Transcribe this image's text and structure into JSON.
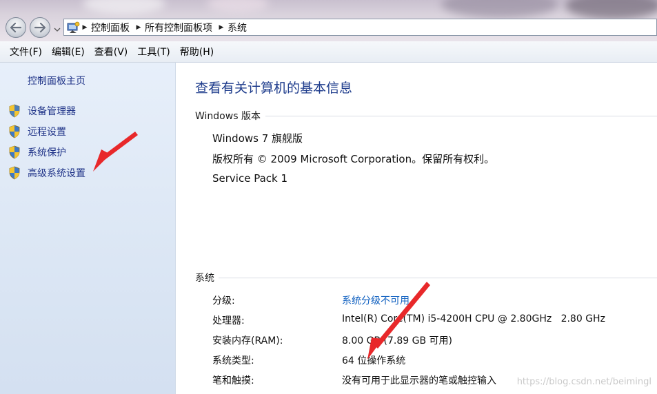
{
  "address": {
    "crumbs": [
      "控制面板",
      "所有控制面板项",
      "系统"
    ]
  },
  "menu": {
    "items": [
      "文件(F)",
      "编辑(E)",
      "查看(V)",
      "工具(T)",
      "帮助(H)"
    ]
  },
  "sidebar": {
    "home_label": "控制面板主页",
    "items": [
      {
        "label": "设备管理器",
        "icon": "shield-icon"
      },
      {
        "label": "远程设置",
        "icon": "shield-icon"
      },
      {
        "label": "系统保护",
        "icon": "shield-icon"
      },
      {
        "label": "高级系统设置",
        "icon": "shield-icon"
      }
    ]
  },
  "main": {
    "title": "查看有关计算机的基本信息",
    "edition": {
      "header": "Windows 版本",
      "name": "Windows 7 旗舰版",
      "copyright": "版权所有 © 2009 Microsoft Corporation。保留所有权利。",
      "service_pack": "Service Pack 1"
    },
    "system": {
      "header": "系统",
      "rows": [
        {
          "key": "分级:",
          "value": "系统分级不可用"
        },
        {
          "key": "处理器:",
          "value": "Intel(R) Core(TM) i5-4200H CPU @ 2.80GHz   2.80 GHz"
        },
        {
          "key": "安装内存(RAM):",
          "value": "8.00 GB (7.89 GB 可用)"
        },
        {
          "key": "系统类型:",
          "value": "64 位操作系统"
        },
        {
          "key": "笔和触摸:",
          "value": "没有可用于此显示器的笔或触控输入"
        }
      ]
    }
  },
  "watermark": "https://blog.csdn.net/beimingl",
  "colors": {
    "link": "#1e3287",
    "title": "#1e3c8c",
    "rating_link": "#1060c0",
    "annotation_arrow": "#e8282a"
  }
}
